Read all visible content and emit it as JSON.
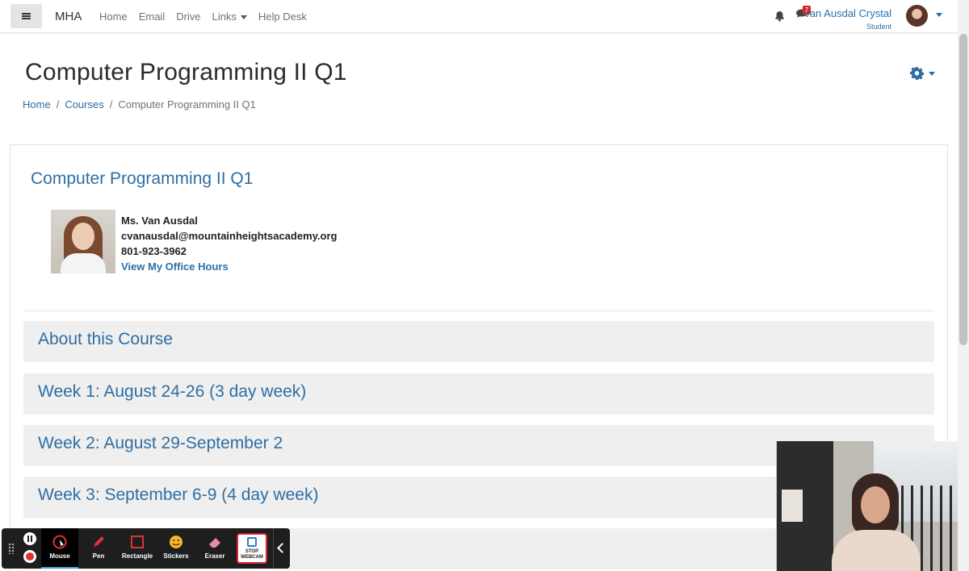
{
  "navbar": {
    "brand": "MHA",
    "links": [
      "Home",
      "Email",
      "Drive",
      "Links",
      "Help Desk"
    ],
    "notification_count": "7",
    "user_name": "Van Ausdal Crystal",
    "user_role": "Student"
  },
  "header": {
    "title": "Computer Programming II Q1",
    "breadcrumb": [
      "Home",
      "Courses",
      "Computer Programming II Q1"
    ]
  },
  "course": {
    "heading": "Computer Programming II Q1",
    "teacher_name": "Ms. Van Ausdal",
    "teacher_email": "cvanausdal@mountainheightsacademy.org",
    "teacher_phone": "801-923-3962",
    "office_hours_link": "View My Office Hours"
  },
  "sections": [
    "About this Course",
    "Week 1: August 24-26 (3 day week)",
    "Week 2: August 29-September 2",
    "Week 3: September 6-9 (4 day week)"
  ],
  "toolbar": {
    "tools": [
      "Mouse",
      "Pen",
      "Rectangle",
      "Stickers",
      "Eraser"
    ],
    "webcam_label": "STOP WEBCAM"
  },
  "colors": {
    "link": "#2f6ea3",
    "section_bg": "#efefef",
    "toolbar_bg": "#1e1e1e"
  }
}
